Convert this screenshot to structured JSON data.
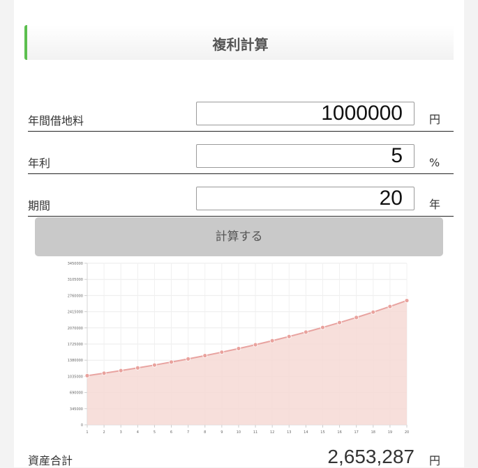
{
  "header": {
    "title": "複利計算"
  },
  "form": {
    "rent": {
      "label": "年間借地料",
      "value": "1000000",
      "unit": "円"
    },
    "rate": {
      "label": "年利",
      "value": "5",
      "unit": "%"
    },
    "period": {
      "label": "期間",
      "value": "20",
      "unit": "年"
    },
    "calc_label": "計算する"
  },
  "chart_data": {
    "type": "area",
    "x": [
      1,
      2,
      3,
      4,
      5,
      6,
      7,
      8,
      9,
      10,
      11,
      12,
      13,
      14,
      15,
      16,
      17,
      18,
      19,
      20
    ],
    "values": [
      1050000,
      1102500,
      1157625,
      1215506,
      1276282,
      1340096,
      1407100,
      1477455,
      1551328,
      1628895,
      1710339,
      1795856,
      1885649,
      1979932,
      2078928,
      2182875,
      2292018,
      2406619,
      2526950,
      2653298
    ],
    "yticks": [
      "0",
      "345000",
      "690000",
      "1035000",
      "1380000",
      "1725000",
      "2070000",
      "2415000",
      "2760000",
      "3105000",
      "3450000"
    ],
    "ylim": [
      0,
      3450000
    ],
    "grid": true,
    "colors": {
      "line": "#e8a3a0",
      "fill": "#f6d9d5",
      "point": "#e9a29d"
    }
  },
  "result": {
    "label": "資産合計",
    "value": "2,653,287",
    "unit": "円"
  }
}
